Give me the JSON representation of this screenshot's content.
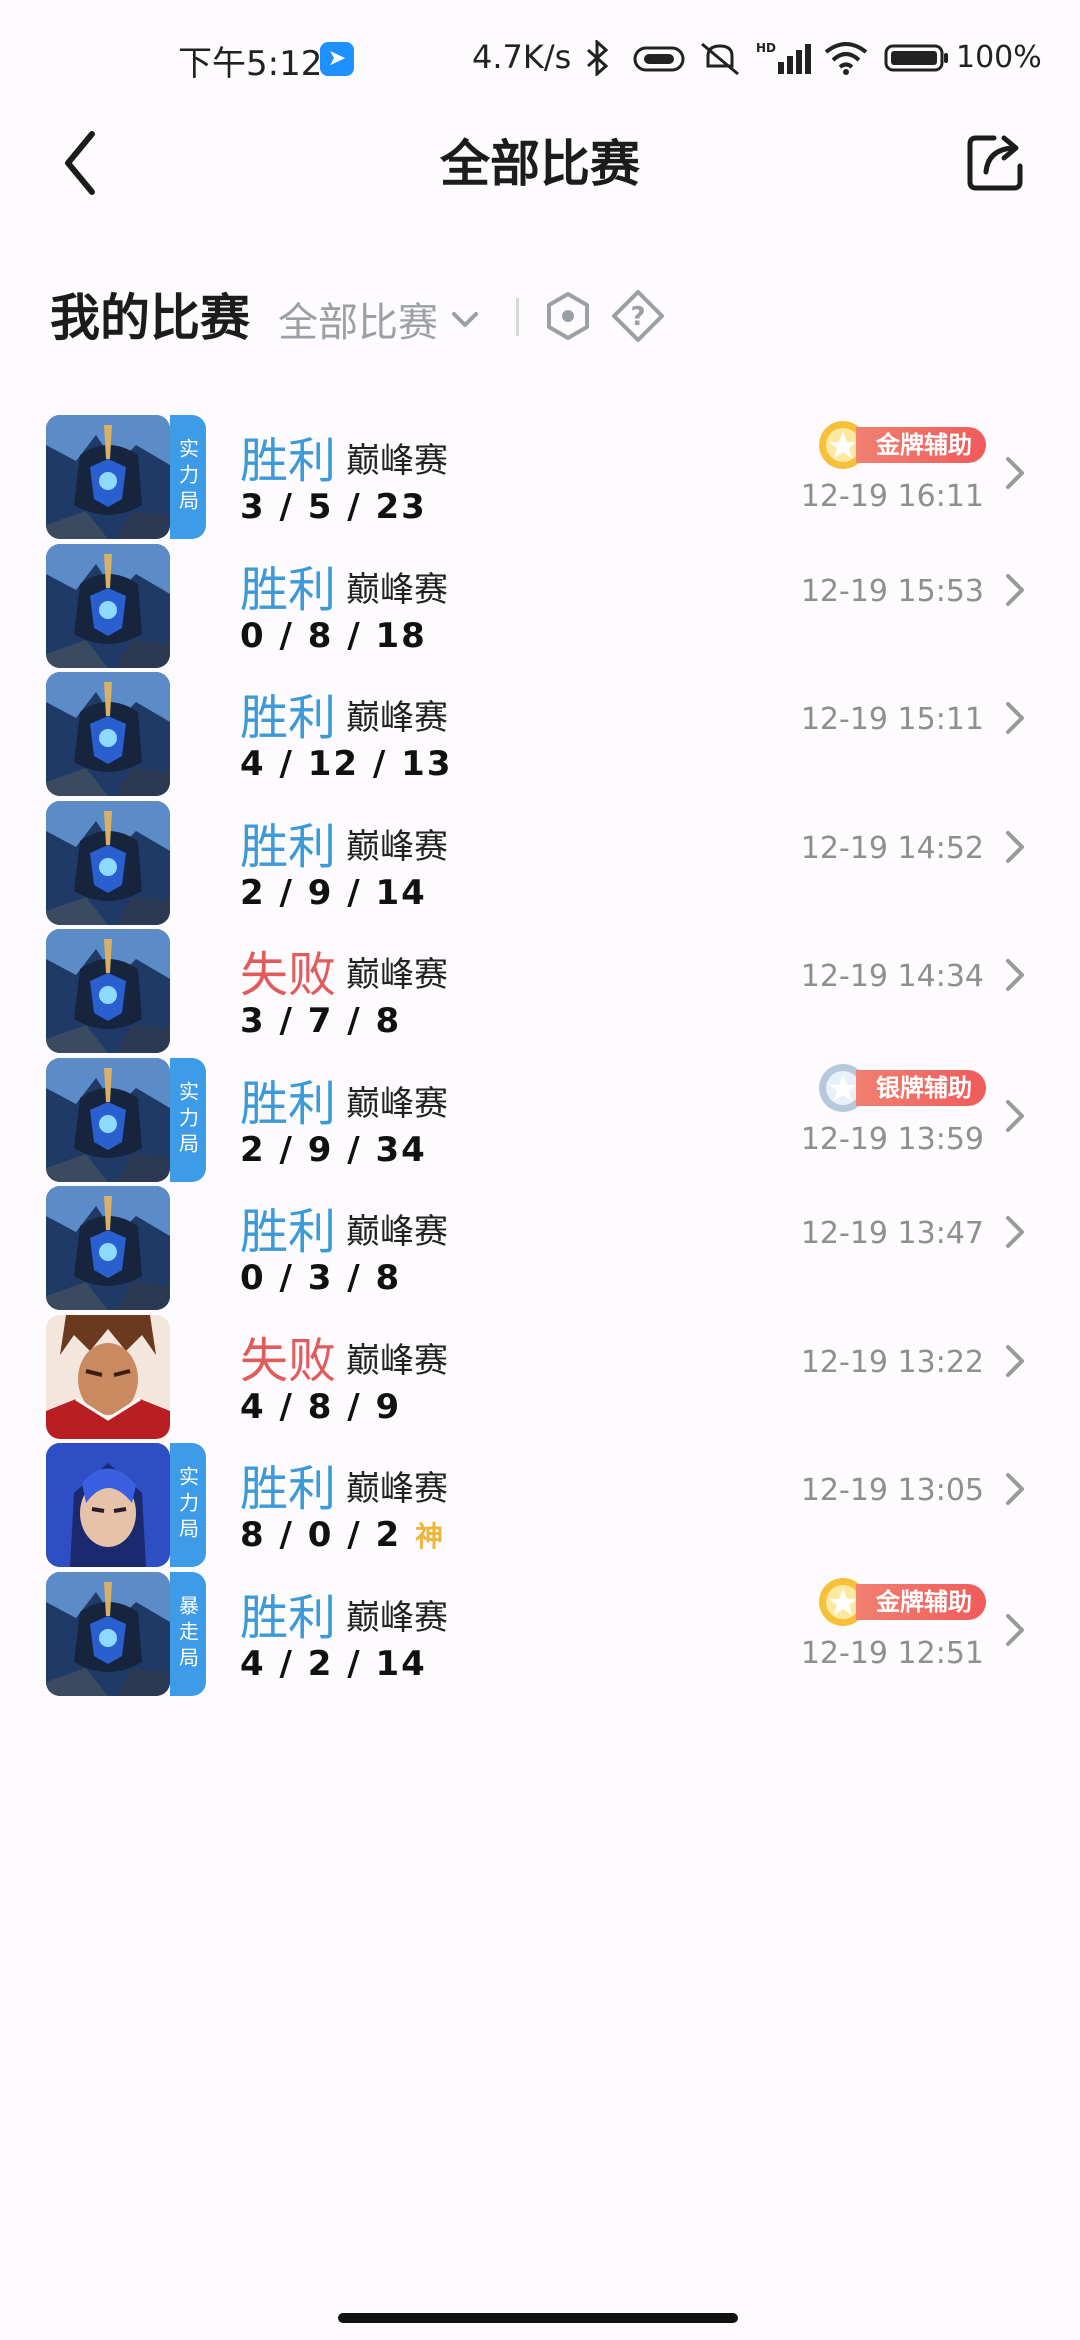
{
  "status_bar": {
    "time": "下午5:12",
    "network_speed": "4.7K/s",
    "battery": "100%"
  },
  "header": {
    "title": "全部比赛"
  },
  "filter": {
    "title": "我的比赛",
    "selected": "全部比赛"
  },
  "matches": [
    {
      "result": "胜利",
      "outcome": "win",
      "mode": "巅峰赛",
      "kda": "3 / 5 / 23",
      "time": "12-19 16:11",
      "tag": "实力局",
      "badge": "金牌辅助",
      "badge_type": "gold",
      "hero": "blue-armor"
    },
    {
      "result": "胜利",
      "outcome": "win",
      "mode": "巅峰赛",
      "kda": "0 / 8 / 18",
      "time": "12-19 15:53",
      "tag": "",
      "badge": "",
      "badge_type": "",
      "hero": "blue-armor"
    },
    {
      "result": "胜利",
      "outcome": "win",
      "mode": "巅峰赛",
      "kda": "4 / 12 / 13",
      "time": "12-19 15:11",
      "tag": "",
      "badge": "",
      "badge_type": "",
      "hero": "blue-armor"
    },
    {
      "result": "胜利",
      "outcome": "win",
      "mode": "巅峰赛",
      "kda": "2 / 9 / 14",
      "time": "12-19 14:52",
      "tag": "",
      "badge": "",
      "badge_type": "",
      "hero": "blue-armor"
    },
    {
      "result": "失败",
      "outcome": "lose",
      "mode": "巅峰赛",
      "kda": "3 / 7 / 8",
      "time": "12-19 14:34",
      "tag": "",
      "badge": "",
      "badge_type": "",
      "hero": "blue-armor"
    },
    {
      "result": "胜利",
      "outcome": "win",
      "mode": "巅峰赛",
      "kda": "2 / 9 / 34",
      "time": "12-19 13:59",
      "tag": "实力局",
      "badge": "银牌辅助",
      "badge_type": "silver",
      "hero": "blue-armor"
    },
    {
      "result": "胜利",
      "outcome": "win",
      "mode": "巅峰赛",
      "kda": "0 / 3 / 8",
      "time": "12-19 13:47",
      "tag": "",
      "badge": "",
      "badge_type": "",
      "hero": "blue-armor"
    },
    {
      "result": "失败",
      "outcome": "lose",
      "mode": "巅峰赛",
      "kda": "4 / 8 / 9",
      "time": "12-19 13:22",
      "tag": "",
      "badge": "",
      "badge_type": "",
      "hero": "red-warrior"
    },
    {
      "result": "胜利",
      "outcome": "win",
      "mode": "巅峰赛",
      "kda": "8 / 0 / 2",
      "kda_extra": "神",
      "time": "12-19 13:05",
      "tag": "实力局",
      "badge": "",
      "badge_type": "",
      "hero": "blue-hair"
    },
    {
      "result": "胜利",
      "outcome": "win",
      "mode": "巅峰赛",
      "kda": "4 / 2 / 14",
      "time": "12-19 12:51",
      "tag": "暴走局",
      "badge": "金牌辅助",
      "badge_type": "gold",
      "hero": "blue-armor"
    }
  ]
}
